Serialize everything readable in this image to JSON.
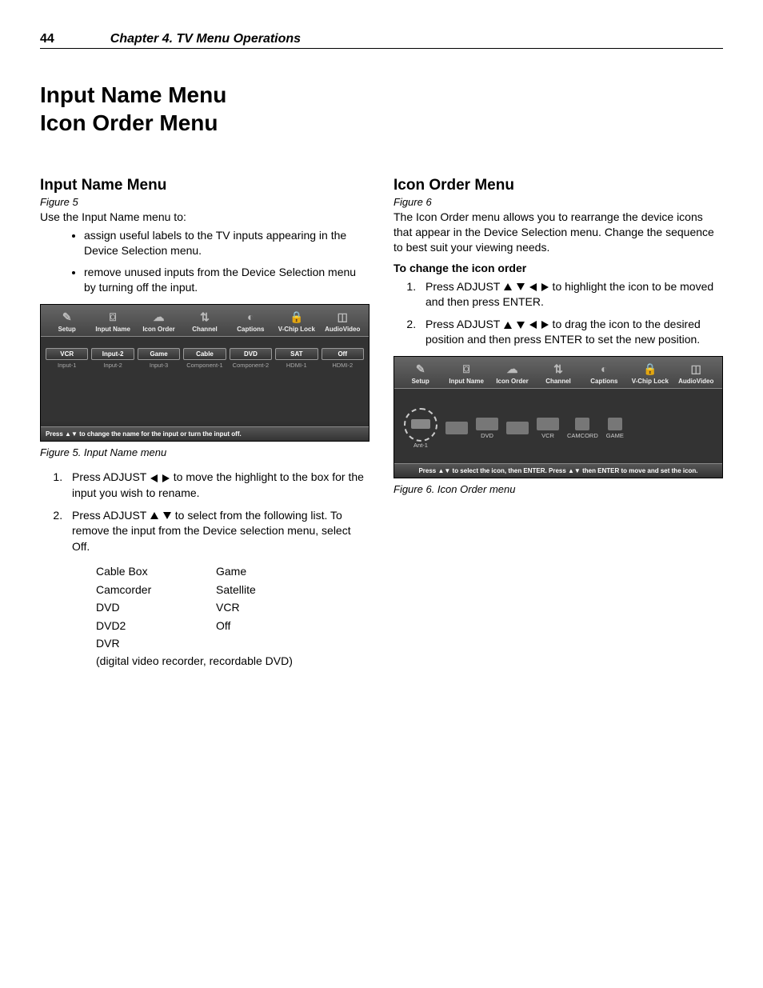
{
  "header": {
    "page": "44",
    "chapter": "Chapter 4. TV Menu Operations"
  },
  "title": {
    "l1": "Input Name Menu",
    "l2": "Icon Order Menu"
  },
  "left": {
    "heading": "Input Name Menu",
    "figref": "Figure 5",
    "intro": "Use the Input Name menu to:",
    "b1": "assign useful labels to the TV inputs appearing in the Device Selection menu.",
    "b2": "remove unused inputs from the Device Selection menu by turning off the input.",
    "tabs": {
      "t1": "Setup",
      "t2": "Input Name",
      "t3": "Icon Order",
      "t4": "Channel",
      "t5": "Captions",
      "t6": "V-Chip Lock",
      "t7": "AudioVideo"
    },
    "row1": {
      "c1": "VCR",
      "c2": "Input-2",
      "c3": "Game",
      "c4": "Cable",
      "c5": "DVD",
      "c6": "SAT",
      "c7": "Off"
    },
    "row2": {
      "c1": "Input-1",
      "c2": "Input-2",
      "c3": "Input-3",
      "c4": "Component-1",
      "c5": "Component-2",
      "c6": "HDMI-1",
      "c7": "HDMI-2"
    },
    "tvfoot": "Press ▲▼ to change the name for the input or turn the input off.",
    "caption": "Figure 5.  Input Name menu",
    "s1a": "Press ADJUST ",
    "s1b": " to move the highlight to the box for the input you wish to rename.",
    "s2a": "Press ADJUST ",
    "s2b": "  to select from the following list.  To remove the input from the Device selection menu, select Off.",
    "names": {
      "a1": "Cable Box",
      "b1": "Game",
      "a2": "Camcorder",
      "b2": "Satellite",
      "a3": "DVD",
      "b3": "VCR",
      "a4": "DVD2",
      "b4": "Off",
      "a5": "DVR",
      "a6": "(digital video recorder, recordable DVD)"
    }
  },
  "right": {
    "heading": "Icon Order Menu",
    "figref": "Figure 6",
    "intro": "The Icon Order menu allows you to rearrange the device icons that appear in the Device Selection menu.  Change the sequence to best suit your viewing needs.",
    "subhead": "To change the icon order",
    "s1a": "Press ADJUST ",
    "s1b": " to highlight the icon to be moved and then press ENTER.",
    "s2a": "Press ADJUST ",
    "s2b": " to drag the icon to the desired position and then press ENTER to set the new position.",
    "icons": {
      "i1": "Ant-1",
      "i2": "",
      "i3": "DVD",
      "i4": "",
      "i5": "VCR",
      "i6": "CAMCORD",
      "i7": "GAME"
    },
    "tvfoot": "Press ▲▼ to select the icon, then ENTER.  Press ▲▼ then ENTER to move and set the icon.",
    "caption": "Figure 6.  Icon Order menu"
  }
}
